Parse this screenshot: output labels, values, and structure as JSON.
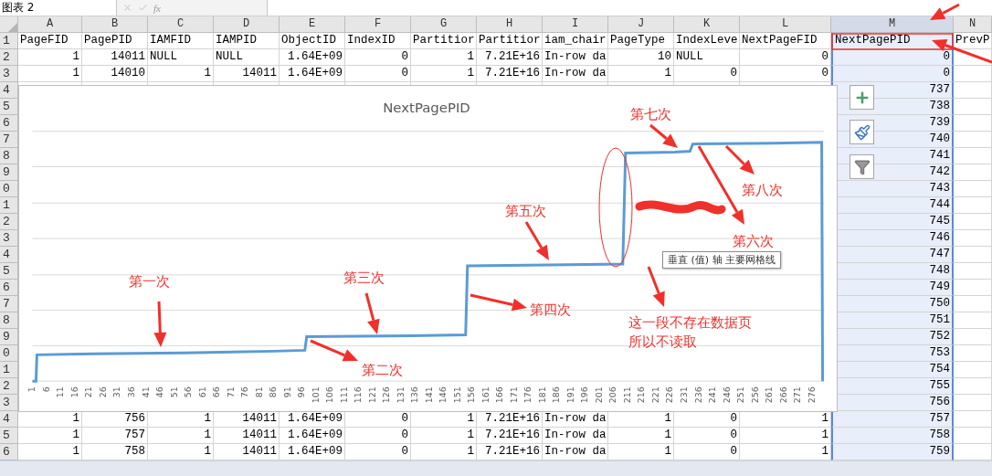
{
  "formula_bar": {
    "name_box": "图表 2",
    "function_label": "fx"
  },
  "columns": [
    {
      "letter": "A",
      "selected": false
    },
    {
      "letter": "B",
      "selected": false
    },
    {
      "letter": "C",
      "selected": false
    },
    {
      "letter": "D",
      "selected": false
    },
    {
      "letter": "E",
      "selected": false
    },
    {
      "letter": "F",
      "selected": false
    },
    {
      "letter": "G",
      "selected": false
    },
    {
      "letter": "H",
      "selected": false
    },
    {
      "letter": "I",
      "selected": false
    },
    {
      "letter": "J",
      "selected": false
    },
    {
      "letter": "K",
      "selected": false
    },
    {
      "letter": "L",
      "selected": false
    },
    {
      "letter": "M",
      "selected": true
    },
    {
      "letter": "N",
      "selected": false
    }
  ],
  "rows": [
    {
      "number": "1",
      "cells": [
        "PageFID",
        "PagePID",
        "IAMFID",
        "IAMPID",
        "ObjectID",
        "IndexID",
        "Partitior",
        "Partitior",
        "iam_chair",
        "PageType",
        "IndexLeve",
        "NextPageFID",
        "NextPagePID",
        "PrevP"
      ]
    },
    {
      "number": "2",
      "cells": [
        "1",
        "14011",
        "NULL",
        "NULL",
        "1.64E+09",
        "0",
        "1",
        "7.21E+16",
        "In-row da",
        "10",
        "NULL",
        "0",
        "0"
      ]
    },
    {
      "number": "3",
      "cells": [
        "1",
        "14010",
        "1",
        "14011",
        "1.64E+09",
        "0",
        "1",
        "7.21E+16",
        "In-row da",
        "1",
        "0",
        "0",
        "0"
      ]
    },
    {
      "number": "4",
      "next_page_pid": "737"
    },
    {
      "number": "5",
      "next_page_pid": "738"
    },
    {
      "number": "6",
      "next_page_pid": "739"
    },
    {
      "number": "7",
      "next_page_pid": "740"
    },
    {
      "number": "8",
      "next_page_pid": "741"
    },
    {
      "number": "9",
      "next_page_pid": "742"
    },
    {
      "number": "0",
      "next_page_pid": "743"
    },
    {
      "number": "1",
      "next_page_pid": "744"
    },
    {
      "number": "2",
      "next_page_pid": "745"
    },
    {
      "number": "3",
      "next_page_pid": "746"
    },
    {
      "number": "4",
      "next_page_pid": "747"
    },
    {
      "number": "5",
      "next_page_pid": "748"
    },
    {
      "number": "6",
      "next_page_pid": "749"
    },
    {
      "number": "7",
      "next_page_pid": "750"
    },
    {
      "number": "8",
      "next_page_pid": "751"
    },
    {
      "number": "9",
      "next_page_pid": "752"
    },
    {
      "number": "0",
      "next_page_pid": "753"
    },
    {
      "number": "1",
      "next_page_pid": "754"
    },
    {
      "number": "2",
      "next_page_pid": "755"
    },
    {
      "number": "3",
      "next_page_pid": "756"
    },
    {
      "number": "4",
      "cells": [
        "1",
        "756",
        "1",
        "14011",
        "1.64E+09",
        "0",
        "1",
        "7.21E+16",
        "In-row da",
        "1",
        "0",
        "1",
        "757"
      ]
    },
    {
      "number": "5",
      "cells": [
        "1",
        "757",
        "1",
        "14011",
        "1.64E+09",
        "0",
        "1",
        "7.21E+16",
        "In-row da",
        "1",
        "0",
        "1",
        "758"
      ]
    },
    {
      "number": "6",
      "cells": [
        "1",
        "758",
        "1",
        "14011",
        "1.64E+09",
        "0",
        "1",
        "7.21E+16",
        "In-row da",
        "1",
        "0",
        "1",
        "759"
      ]
    }
  ],
  "chart": {
    "title": "NextPagePID",
    "tooltip": "垂直 (值) 轴 主要网格线",
    "x_axis_labels": [
      "1",
      "6",
      "11",
      "16",
      "21",
      "26",
      "31",
      "36",
      "41",
      "46",
      "51",
      "56",
      "61",
      "66",
      "71",
      "76",
      "81",
      "86",
      "91",
      "96",
      "101",
      "106",
      "111",
      "116",
      "121",
      "126",
      "131",
      "136",
      "141",
      "146",
      "151",
      "156",
      "161",
      "166",
      "171",
      "176",
      "181",
      "186",
      "191",
      "196",
      "201",
      "206",
      "211",
      "216",
      "221",
      "226",
      "231",
      "236",
      "241",
      "246",
      "251",
      "256",
      "261",
      "266",
      "271",
      "276"
    ]
  },
  "annotations": [
    {
      "text": "第一次"
    },
    {
      "text": "第二次"
    },
    {
      "text": "第三次"
    },
    {
      "text": "第四次"
    },
    {
      "text": "第五次"
    },
    {
      "text": "第六次"
    },
    {
      "text": "第七次"
    },
    {
      "text": "第八次"
    },
    {
      "lines": [
        "这一段不存在数据页",
        "所以不读取"
      ]
    }
  ]
}
